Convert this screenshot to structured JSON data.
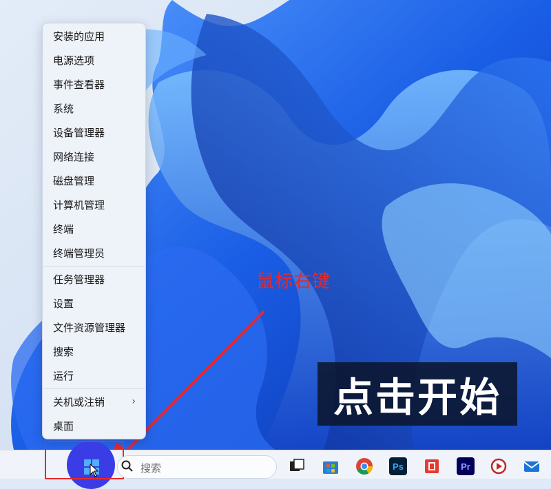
{
  "context_menu": {
    "items": [
      {
        "label": "安装的应用"
      },
      {
        "label": "电源选项"
      },
      {
        "label": "事件查看器"
      },
      {
        "label": "系统"
      },
      {
        "label": "设备管理器"
      },
      {
        "label": "网络连接"
      },
      {
        "label": "磁盘管理"
      },
      {
        "label": "计算机管理"
      },
      {
        "label": "终端"
      },
      {
        "label": "终端管理员"
      },
      {
        "label": "任务管理器"
      },
      {
        "label": "设置"
      },
      {
        "label": "文件资源管理器"
      },
      {
        "label": "搜索"
      },
      {
        "label": "运行"
      },
      {
        "label": "关机或注销",
        "submenu": true
      },
      {
        "label": "桌面"
      }
    ]
  },
  "annotation": {
    "label": "鼠标右键"
  },
  "caption": {
    "text": "点击开始"
  },
  "taskbar": {
    "search_placeholder": "搜索",
    "apps": [
      {
        "name": "task-view-icon",
        "label": ""
      },
      {
        "name": "microsoft-store-icon",
        "label": ""
      },
      {
        "name": "chrome-icon",
        "label": ""
      },
      {
        "name": "photoshop-icon",
        "label": "Ps"
      },
      {
        "name": "wps-icon",
        "label": ""
      },
      {
        "name": "premiere-icon",
        "label": "Pr"
      },
      {
        "name": "media-player-icon",
        "label": ""
      },
      {
        "name": "mail-icon",
        "label": ""
      }
    ]
  },
  "colors": {
    "accent": "#3a3ce6",
    "annotation": "#e8282a",
    "wallpaper": "#1f5fe0"
  }
}
